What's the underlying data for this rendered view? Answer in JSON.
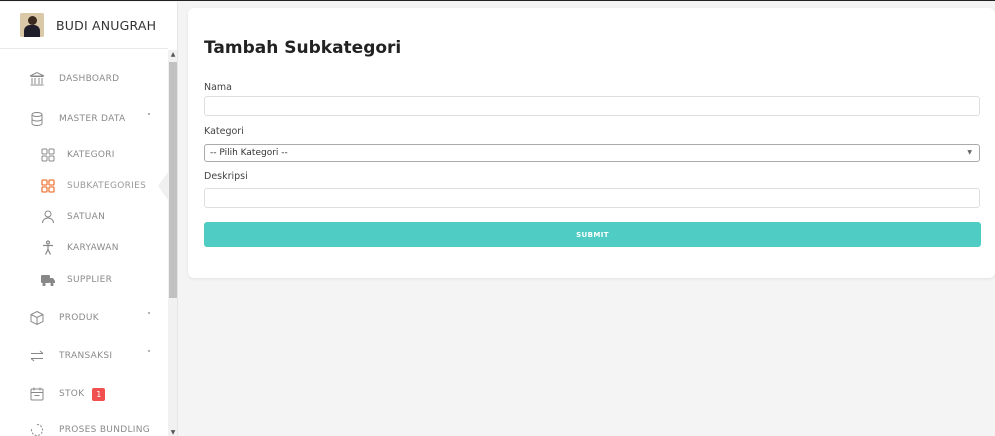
{
  "user": {
    "name": "BUDI ANUGRAH"
  },
  "sidebar": {
    "items": [
      {
        "label": "DASHBOARD",
        "icon": "bank-icon"
      },
      {
        "label": "MASTER DATA",
        "icon": "database-icon",
        "has_caret": true
      },
      {
        "label": "KATEGORI",
        "icon": "grid-icon"
      },
      {
        "label": "SUBKATEGORIES",
        "icon": "grid-icon",
        "active": true
      },
      {
        "label": "SATUAN",
        "icon": "user-icon"
      },
      {
        "label": "KARYAWAN",
        "icon": "person-icon"
      },
      {
        "label": "SUPPLIER",
        "icon": "truck-icon"
      },
      {
        "label": "PRODUK",
        "icon": "box-icon",
        "has_caret": true
      },
      {
        "label": "TRANSAKSI",
        "icon": "transfer-icon",
        "has_caret": true
      },
      {
        "label": "STOK",
        "icon": "calendar-icon",
        "badge": "1"
      },
      {
        "label": "PROSES BUNDLING",
        "icon": "loader-icon"
      }
    ],
    "caret": "˅"
  },
  "form": {
    "title": "Tambah Subkategori",
    "nama_label": "Nama",
    "nama_value": "",
    "kategori_label": "Kategori",
    "kategori_selected": "-- Pilih Kategori --",
    "deskripsi_label": "Deskripsi",
    "deskripsi_value": "",
    "submit_label": "SUBMIT"
  },
  "colors": {
    "accent": "#4fcdc5",
    "active_icon": "#f0783c",
    "badge": "#f05050"
  }
}
